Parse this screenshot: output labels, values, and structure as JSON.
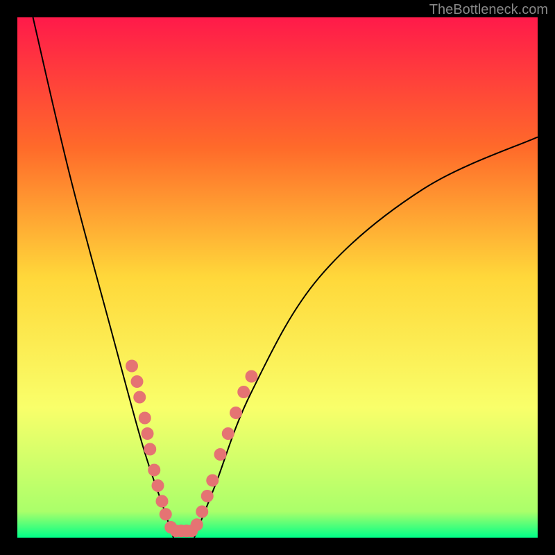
{
  "watermark": "TheBottleneck.com",
  "chart_data": {
    "type": "line",
    "title": "",
    "xlabel": "",
    "ylabel": "",
    "xlim": [
      0,
      100
    ],
    "ylim": [
      0,
      100
    ],
    "gradient_stops": [
      {
        "offset": 0,
        "color": "#ff1a4a"
      },
      {
        "offset": 25,
        "color": "#ff6a2a"
      },
      {
        "offset": 50,
        "color": "#ffd83a"
      },
      {
        "offset": 75,
        "color": "#f9ff6a"
      },
      {
        "offset": 95,
        "color": "#aaff6a"
      },
      {
        "offset": 100,
        "color": "#00ff88"
      }
    ],
    "series": [
      {
        "name": "left-arm",
        "type": "curve",
        "points": [
          {
            "x": 3,
            "y": 100
          },
          {
            "x": 10,
            "y": 70
          },
          {
            "x": 18,
            "y": 40
          },
          {
            "x": 24,
            "y": 18
          },
          {
            "x": 28,
            "y": 6
          },
          {
            "x": 30,
            "y": 0
          }
        ]
      },
      {
        "name": "right-arm",
        "type": "curve",
        "points": [
          {
            "x": 34,
            "y": 0
          },
          {
            "x": 38,
            "y": 10
          },
          {
            "x": 45,
            "y": 28
          },
          {
            "x": 58,
            "y": 50
          },
          {
            "x": 78,
            "y": 67
          },
          {
            "x": 100,
            "y": 77
          }
        ]
      }
    ],
    "scatter_points": [
      {
        "x": 22,
        "y": 33
      },
      {
        "x": 23,
        "y": 30
      },
      {
        "x": 23.5,
        "y": 27
      },
      {
        "x": 24.5,
        "y": 23
      },
      {
        "x": 25,
        "y": 20
      },
      {
        "x": 25.5,
        "y": 17
      },
      {
        "x": 26.3,
        "y": 13
      },
      {
        "x": 27,
        "y": 10
      },
      {
        "x": 27.8,
        "y": 7
      },
      {
        "x": 28.5,
        "y": 4.5
      },
      {
        "x": 29.5,
        "y": 2
      },
      {
        "x": 30.5,
        "y": 1.3
      },
      {
        "x": 31.5,
        "y": 1.3
      },
      {
        "x": 32.5,
        "y": 1.3
      },
      {
        "x": 33.5,
        "y": 1.3
      },
      {
        "x": 34.5,
        "y": 2.5
      },
      {
        "x": 35.5,
        "y": 5
      },
      {
        "x": 36.5,
        "y": 8
      },
      {
        "x": 37.5,
        "y": 11
      },
      {
        "x": 39,
        "y": 16
      },
      {
        "x": 40.5,
        "y": 20
      },
      {
        "x": 42,
        "y": 24
      },
      {
        "x": 43.5,
        "y": 28
      },
      {
        "x": 45,
        "y": 31
      }
    ],
    "scatter_color": "#e57373",
    "curve_color": "#000000"
  }
}
